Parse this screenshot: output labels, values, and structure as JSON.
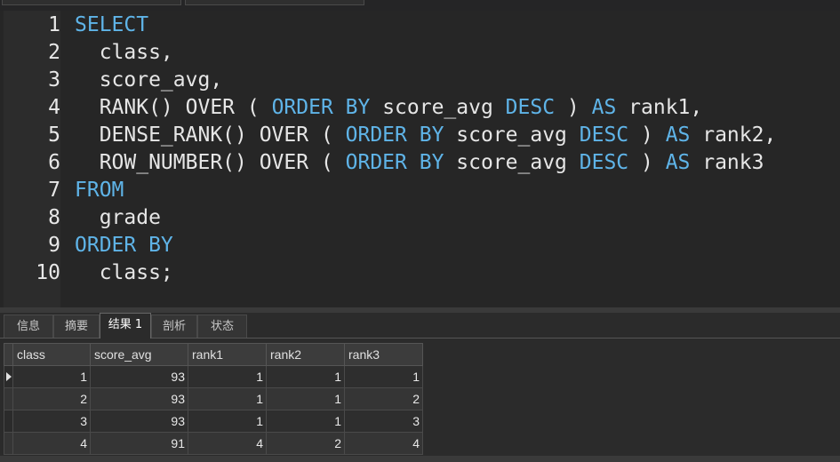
{
  "editor": {
    "line_numbers": [
      "1",
      "2",
      "3",
      "4",
      "5",
      "6",
      "7",
      "8",
      "9",
      "10"
    ],
    "lines": [
      [
        {
          "t": "SELECT",
          "k": true
        }
      ],
      [
        {
          "t": "  class,",
          "k": false
        }
      ],
      [
        {
          "t": "  score_avg,",
          "k": false
        }
      ],
      [
        {
          "t": "  RANK() OVER ( ",
          "k": false
        },
        {
          "t": "ORDER BY",
          "k": true
        },
        {
          "t": " score_avg ",
          "k": false
        },
        {
          "t": "DESC",
          "k": true
        },
        {
          "t": " ) ",
          "k": false
        },
        {
          "t": "AS",
          "k": true
        },
        {
          "t": " rank1,",
          "k": false
        }
      ],
      [
        {
          "t": "  DENSE_RANK() OVER ( ",
          "k": false
        },
        {
          "t": "ORDER BY",
          "k": true
        },
        {
          "t": " score_avg ",
          "k": false
        },
        {
          "t": "DESC",
          "k": true
        },
        {
          "t": " ) ",
          "k": false
        },
        {
          "t": "AS",
          "k": true
        },
        {
          "t": " rank2,",
          "k": false
        }
      ],
      [
        {
          "t": "  ROW_NUMBER() OVER ( ",
          "k": false
        },
        {
          "t": "ORDER BY",
          "k": true
        },
        {
          "t": " score_avg ",
          "k": false
        },
        {
          "t": "DESC",
          "k": true
        },
        {
          "t": " ) ",
          "k": false
        },
        {
          "t": "AS",
          "k": true
        },
        {
          "t": " rank3",
          "k": false
        }
      ],
      [
        {
          "t": "FROM",
          "k": true
        }
      ],
      [
        {
          "t": "  grade",
          "k": false
        }
      ],
      [
        {
          "t": "ORDER BY",
          "k": true
        }
      ],
      [
        {
          "t": "  class;",
          "k": false
        }
      ]
    ],
    "colors": {
      "keyword": "#5fb4e8",
      "text": "#e6e6e6"
    }
  },
  "result_tabs": {
    "info": "信息",
    "summary": "摘要",
    "result1": "结果 1",
    "profile": "剖析",
    "status": "状态"
  },
  "grid": {
    "columns": [
      "class",
      "score_avg",
      "rank1",
      "rank2",
      "rank3"
    ],
    "rows": [
      [
        "1",
        "93",
        "1",
        "1",
        "1"
      ],
      [
        "2",
        "93",
        "1",
        "1",
        "2"
      ],
      [
        "3",
        "93",
        "1",
        "1",
        "3"
      ],
      [
        "4",
        "91",
        "4",
        "2",
        "4"
      ]
    ]
  }
}
